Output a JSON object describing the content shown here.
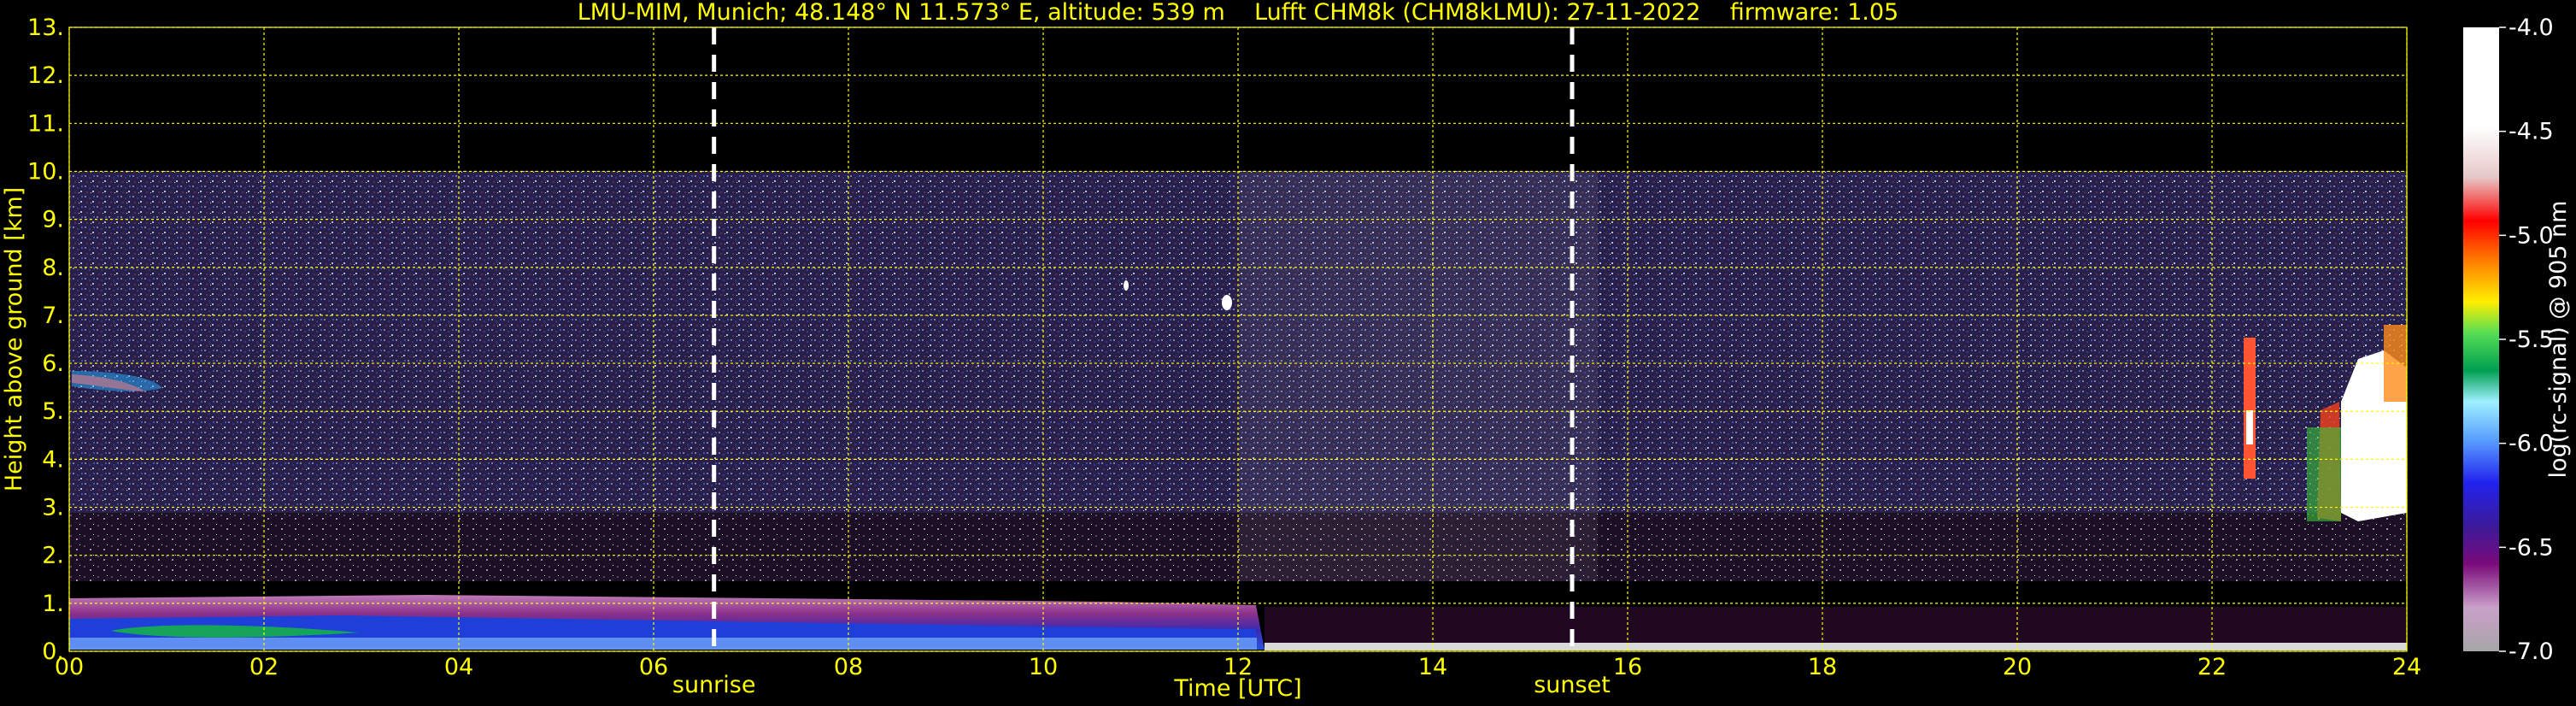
{
  "chart_data": {
    "type": "heatmap",
    "title": "LMU-MIM, Munich; 48.148° N 11.573° E, altitude: 539 m    Lufft CHM8k (CHM8kLMU): 27-11-2022    firmware: 1.05",
    "xlabel": "Time [UTC]",
    "ylabel": "Height above ground [km]",
    "xlim": [
      0,
      24
    ],
    "ylim": [
      0,
      13
    ],
    "x_ticks": [
      "00",
      "02",
      "04",
      "06",
      "08",
      "10",
      "12",
      "14",
      "16",
      "18",
      "20",
      "22",
      "24"
    ],
    "y_ticks": [
      "0.",
      "1.",
      "2.",
      "3.",
      "4.",
      "5.",
      "6.",
      "7.",
      "8.",
      "9.",
      "10.",
      "11.",
      "12.",
      "13."
    ],
    "grid": true,
    "markers": [
      {
        "label": "sunrise",
        "time": 6.62
      },
      {
        "label": "sunset",
        "time": 15.43
      }
    ],
    "colorbar": {
      "label": "log(rc-signal) @ 905 nm",
      "range": [
        -7.0,
        -4.0
      ],
      "ticks": [
        "-4.0",
        "-4.5",
        "-5.0",
        "-5.5",
        "-6.0",
        "-6.5",
        "-7.0"
      ]
    },
    "features": [
      {
        "name": "boundary layer aerosol",
        "t_start": 0,
        "t_end": 12.3,
        "h_top": 1.0
      },
      {
        "name": "near-surface layer",
        "t_start": 12.3,
        "t_end": 24,
        "h_top": 0.2
      },
      {
        "name": "aerosol/cloud layer",
        "t_start": 0,
        "t_end": 1.0,
        "h_min": 5.4,
        "h_max": 5.8
      },
      {
        "name": "cloud",
        "t_start": 23.1,
        "t_end": 24,
        "h_min": 2.8,
        "h_max": 6.5
      },
      {
        "name": "cloud",
        "t_start": 22.3,
        "t_end": 22.5,
        "h_min": 3.8,
        "h_max": 6.4
      }
    ],
    "signal_top_km": 10
  },
  "colors": {
    "text": "#ffff00",
    "grid": "#ffff00",
    "background": "#000000",
    "colormap": [
      "#a6a6a6",
      "#7a3d7a",
      "#3b1a99",
      "#2222ee",
      "#5aa0ff",
      "#9ff0ff",
      "#00a050",
      "#55dd55",
      "#ffee00",
      "#ff8800",
      "#ff0000",
      "#ffffff"
    ]
  }
}
